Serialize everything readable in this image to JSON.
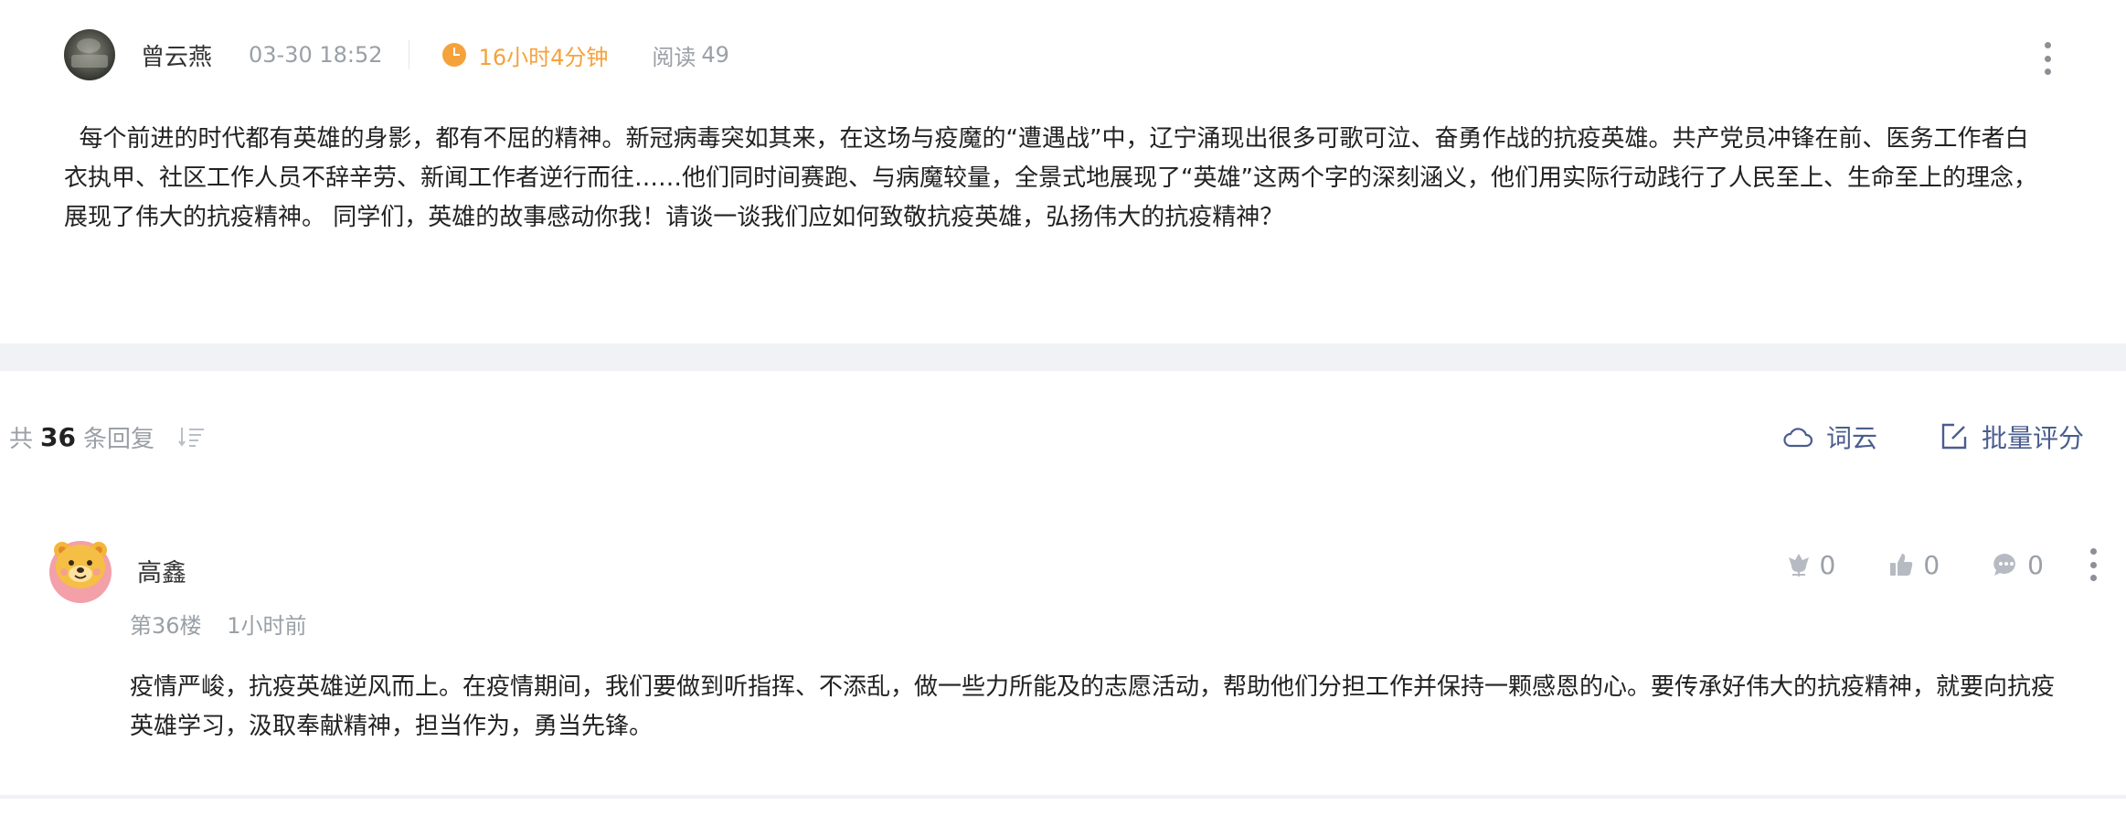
{
  "post": {
    "author": "曾云燕",
    "time": "03-30 18:52",
    "duration": "16小时4分钟",
    "read_label": "阅读",
    "read_count": "49",
    "body": "每个前进的时代都有英雄的身影，都有不屈的精神。新冠病毒突如其来，在这场与疫魔的“遭遇战”中，辽宁涌现出很多可歌可泣、奋勇作战的抗疫英雄。共产党员冲锋在前、医务工作者白衣执甲、社区工作人员不辞辛劳、新闻工作者逆行而往……他们同时间赛跑、与病魔较量，全景式地展现了“英雄”这两个字的深刻涵义，他们用实际行动践行了人民至上、生命至上的理念，展现了伟大的抗疫精神。 同学们，英雄的故事感动你我！请谈一谈我们应如何致敬抗疫英雄，弘扬伟大的抗疫精神？"
  },
  "replies_bar": {
    "prefix": "共",
    "count": "36",
    "suffix": "条回复",
    "word_cloud_label": "词云",
    "batch_grade_label": "批量评分"
  },
  "reply": {
    "name": "高鑫",
    "floor": "第36楼",
    "time": "1小时前",
    "flower_count": "0",
    "like_count": "0",
    "comment_count": "0",
    "content": "疫情严峻，抗疫英雄逆风而上。在疫情期间，我们要做到听指挥、不添乱，做一些力所能及的志愿活动，帮助他们分担工作并保持一颗感恩的心。要传承好伟大的抗疫精神，就要向抗疫英雄学习，汲取奉献精神，担当作为，勇当先锋。"
  },
  "icons": {
    "author_avatar": "avatar-photo",
    "clock": "clock-icon",
    "more": "more-vertical-icon",
    "sort": "sort-icon",
    "word_cloud": "cloud-icon",
    "batch_grade": "edit-icon",
    "flower": "flower-icon",
    "like": "thumbs-up-icon",
    "comment": "comment-icon",
    "reply_avatar": "bear-avatar"
  },
  "colors": {
    "accent_orange": "#f6a23b",
    "link_blue": "#4a5d8f",
    "muted_gray": "#9aa0a6",
    "band_gray": "#f0f2f5"
  }
}
